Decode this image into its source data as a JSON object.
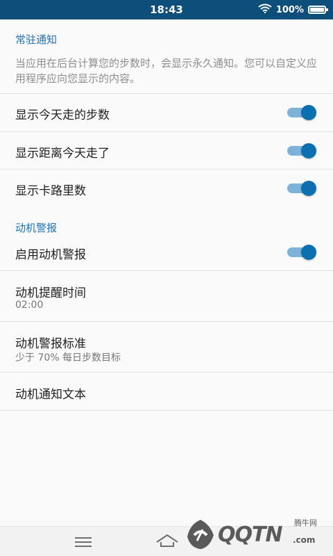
{
  "status_bar": {
    "time": "18:43",
    "battery_text": "100%"
  },
  "section1": {
    "title": "常驻通知",
    "description": "当应用在后台计算您的步数时，会显示永久通知。您可以自定义应用程序应向您显示的内容。"
  },
  "settings1": [
    {
      "label": "显示今天走的步数",
      "enabled": true
    },
    {
      "label": "显示距离今天走了",
      "enabled": true
    },
    {
      "label": "显示卡路里数",
      "enabled": true
    }
  ],
  "section2": {
    "title": "动机警报"
  },
  "settings2": {
    "enable_label": "启用动机警报",
    "enable_on": true,
    "reminder_time_label": "动机提醒时间",
    "reminder_time_value": "02:00",
    "criteria_label": "动机警报标准",
    "criteria_value": "少于 70% 每日步数目标",
    "notification_text_label": "动机通知文本"
  },
  "watermark": {
    "brand": "QQTN",
    "suffix": ".com",
    "small": "腾牛网"
  },
  "colors": {
    "status_bar": "#0d4f7a",
    "accent": "#1e73b5",
    "toggle_thumb": "#0b6fb0",
    "toggle_track": "#7eb3d9"
  },
  "icons": {
    "wifi": "wifi-icon",
    "battery": "battery-icon",
    "menu": "menu-icon",
    "home": "home-icon"
  }
}
